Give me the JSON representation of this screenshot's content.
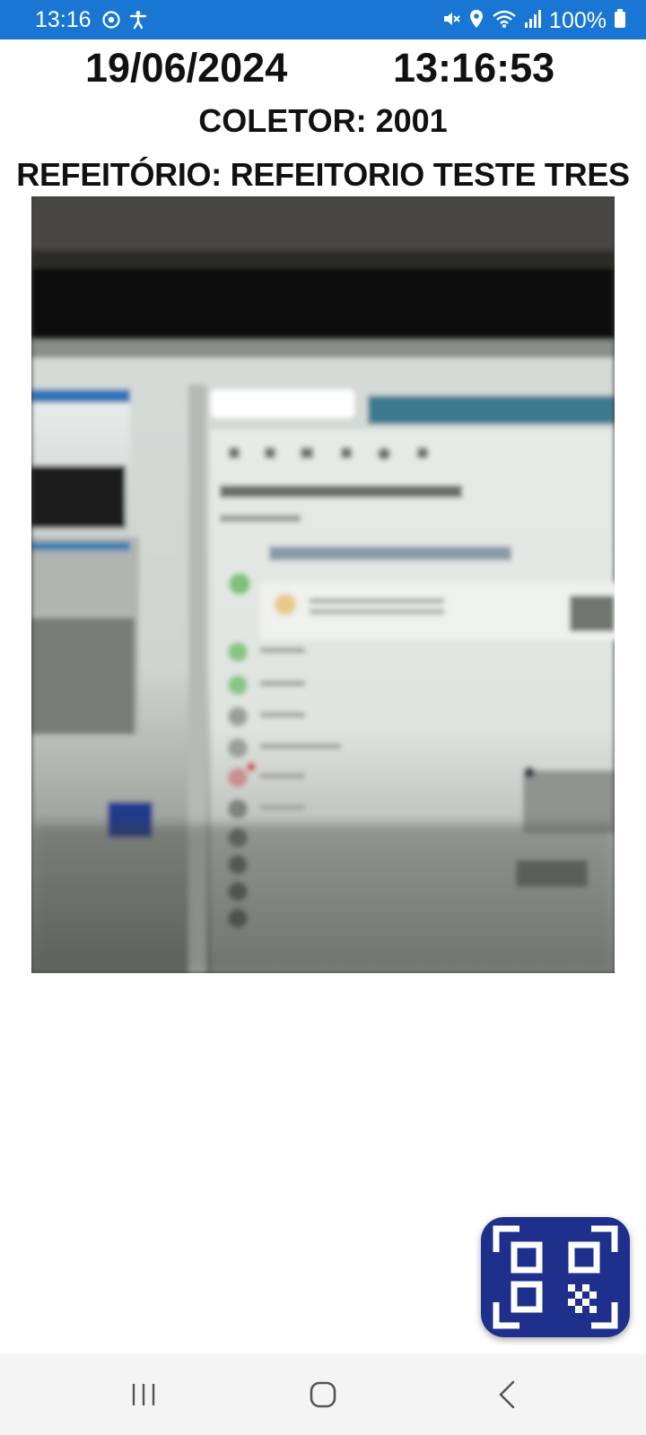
{
  "status_bar": {
    "time": "13:16",
    "battery": "100%",
    "left_icons": [
      "sync-icon",
      "accessibility-icon"
    ],
    "right_icons": [
      "mute-vibrate-icon",
      "location-icon",
      "wifi-icon",
      "signal-icon",
      "battery-icon"
    ],
    "background_color": "#1976d2"
  },
  "header": {
    "date": "19/06/2024",
    "time": "13:16:53",
    "collector": "COLETOR: 2001",
    "refectory": "REFEITÓRIO: REFEITORIO TESTE TRES"
  },
  "qr_button": {
    "icon": "qr-code-scan-icon",
    "color": "#1e2f8c"
  },
  "nav_bar": {
    "buttons": [
      "recent-apps-icon",
      "home-icon",
      "back-icon"
    ]
  }
}
